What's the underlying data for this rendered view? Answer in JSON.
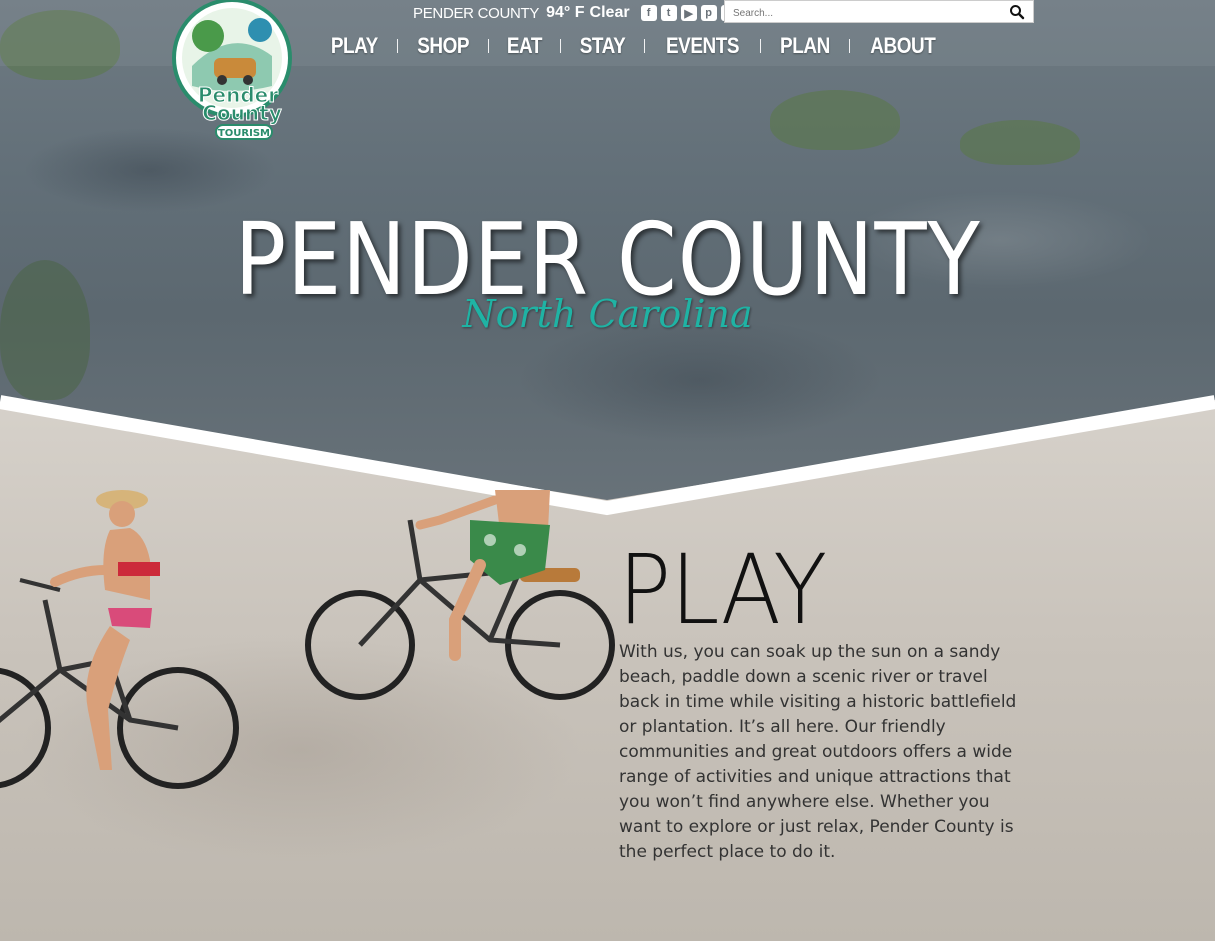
{
  "header": {
    "weather": {
      "county": "PENDER COUNTY",
      "temperature": "94° F",
      "condition": "Clear"
    },
    "social": [
      {
        "icon": "facebook-icon",
        "glyph": "f"
      },
      {
        "icon": "twitter-icon",
        "glyph": "t"
      },
      {
        "icon": "youtube-icon",
        "glyph": "▶"
      },
      {
        "icon": "pinterest-icon",
        "glyph": "p"
      },
      {
        "icon": "instagram-icon",
        "glyph": "◎"
      }
    ],
    "search": {
      "placeholder": "Search..."
    },
    "logo": {
      "line1": "Pender",
      "line2": "County",
      "line3": "TOURISM"
    }
  },
  "nav": {
    "items": [
      {
        "label": "PLAY"
      },
      {
        "label": "SHOP"
      },
      {
        "label": "EAT"
      },
      {
        "label": "STAY"
      },
      {
        "label": "EVENTS"
      },
      {
        "label": "PLAN"
      },
      {
        "label": "ABOUT"
      }
    ]
  },
  "hero": {
    "title": "PENDER COUNTY",
    "subtitle": "North Carolina"
  },
  "play_section": {
    "heading": "PLAY",
    "body": "With us, you can soak up the sun on a sandy beach, paddle down a scenic river or travel back in time while visiting a historic battlefield or plantation. It’s all here. Our friendly communities and great outdoors offers a wide range of activities and unique attractions that you won’t find anywhere else. Whether you want to explore or just relax, Pender County is the perfect place to do it."
  },
  "colors": {
    "accent": "#1fb3a4",
    "nav_text": "#ffffff",
    "body_text": "#333333"
  }
}
